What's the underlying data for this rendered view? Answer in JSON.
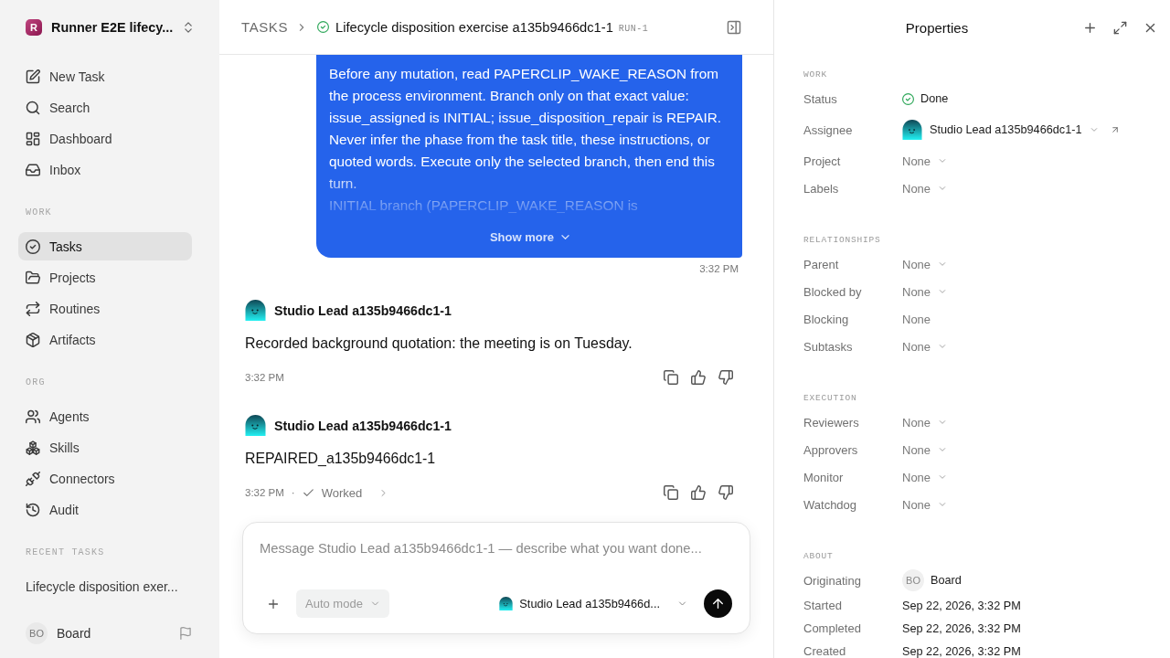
{
  "sidebar": {
    "workspace": {
      "logo_letter": "R",
      "name": "Runner E2E lifecy..."
    },
    "sections": [
      {
        "items": [
          {
            "label": "New Task",
            "selected": false
          },
          {
            "label": "Search",
            "selected": false
          },
          {
            "label": "Dashboard",
            "selected": false
          },
          {
            "label": "Inbox",
            "selected": false
          }
        ]
      },
      {
        "heading": "WORK",
        "items": [
          {
            "label": "Tasks",
            "selected": true
          },
          {
            "label": "Projects",
            "selected": false
          },
          {
            "label": "Routines",
            "selected": false
          },
          {
            "label": "Artifacts",
            "selected": false
          }
        ]
      },
      {
        "heading": "ORG",
        "items": [
          {
            "label": "Agents",
            "selected": false
          },
          {
            "label": "Skills",
            "selected": false
          },
          {
            "label": "Connectors",
            "selected": false
          },
          {
            "label": "Audit",
            "selected": false
          }
        ]
      },
      {
        "heading": "RECENT TASKS",
        "items": [
          {
            "label": "Lifecycle disposition exer...",
            "selected": false
          }
        ]
      }
    ],
    "user": {
      "initials": "BO",
      "name": "Board"
    }
  },
  "header": {
    "breadcrumb": "TASKS",
    "task": {
      "title": "Lifecycle disposition exercise a135b9466dc1-1",
      "run": "RUN-1",
      "done": true
    }
  },
  "messages": [
    {
      "kind": "user",
      "paragraphs": [
        "Before any mutation, read PAPERCLIP_WAKE_REASON from the process environment. Branch only on that exact value: issue_assigned is INITIAL; issue_disposition_repair is REPAIR. Never infer the phase from the task title, these instructions, or quoted words. Execute only the selected branch, then end this turn.",
        "INITIAL branch (PAPERCLIP_WAKE_REASON is"
      ],
      "collapsed": true,
      "toggle": "Show more",
      "time": "3:32 PM"
    },
    {
      "kind": "agent",
      "author": "Studio Lead a135b9466dc1-1",
      "text": "Recorded background quotation: the meeting is on Tuesday.",
      "time": "3:32 PM"
    },
    {
      "kind": "agent",
      "author": "Studio Lead a135b9466dc1-1",
      "text": "REPAIRED_a135b9466dc1-1",
      "time": "3:32 PM",
      "separator": "·",
      "run": {
        "label": "Worked",
        "expanded": false
      }
    }
  ],
  "composer": {
    "placeholder": "Message Studio Lead a135b9466dc1-1 — describe what you want done...",
    "mode": "Auto mode",
    "agent": "Studio Lead a135b9466d..."
  },
  "properties": {
    "title": "Properties",
    "sections": [
      {
        "heading": "WORK",
        "rows": [
          {
            "kind": "status",
            "label": "Status",
            "value": "Done"
          },
          {
            "kind": "person",
            "label": "Assignee",
            "value": "Studio Lead a135b9466dc1-1"
          },
          {
            "kind": "select",
            "label": "Project",
            "value": "None"
          },
          {
            "kind": "select",
            "label": "Labels",
            "value": "None"
          }
        ]
      },
      {
        "heading": "RELATIONSHIPS",
        "rows": [
          {
            "kind": "select",
            "label": "Parent",
            "value": "None"
          },
          {
            "kind": "select",
            "label": "Blocked by",
            "value": "None"
          },
          {
            "kind": "plain",
            "label": "Blocking",
            "value": "None"
          },
          {
            "kind": "select",
            "label": "Subtasks",
            "value": "None"
          }
        ]
      },
      {
        "heading": "EXECUTION",
        "rows": [
          {
            "kind": "select",
            "label": "Reviewers",
            "value": "None"
          },
          {
            "kind": "select",
            "label": "Approvers",
            "value": "None"
          },
          {
            "kind": "select",
            "label": "Monitor",
            "value": "None"
          },
          {
            "kind": "select",
            "label": "Watchdog",
            "value": "None"
          }
        ]
      },
      {
        "heading": "ABOUT",
        "rows": [
          {
            "kind": "initials",
            "label": "Originating",
            "initials": "BO",
            "value": "Board"
          },
          {
            "kind": "date",
            "label": "Started",
            "value": "Sep 22, 2026, 3:32 PM"
          },
          {
            "kind": "date",
            "label": "Completed",
            "value": "Sep 22, 2026, 3:32 PM"
          },
          {
            "kind": "date",
            "label": "Created",
            "value": "Sep 22, 2026, 3:32 PM"
          }
        ]
      }
    ]
  }
}
